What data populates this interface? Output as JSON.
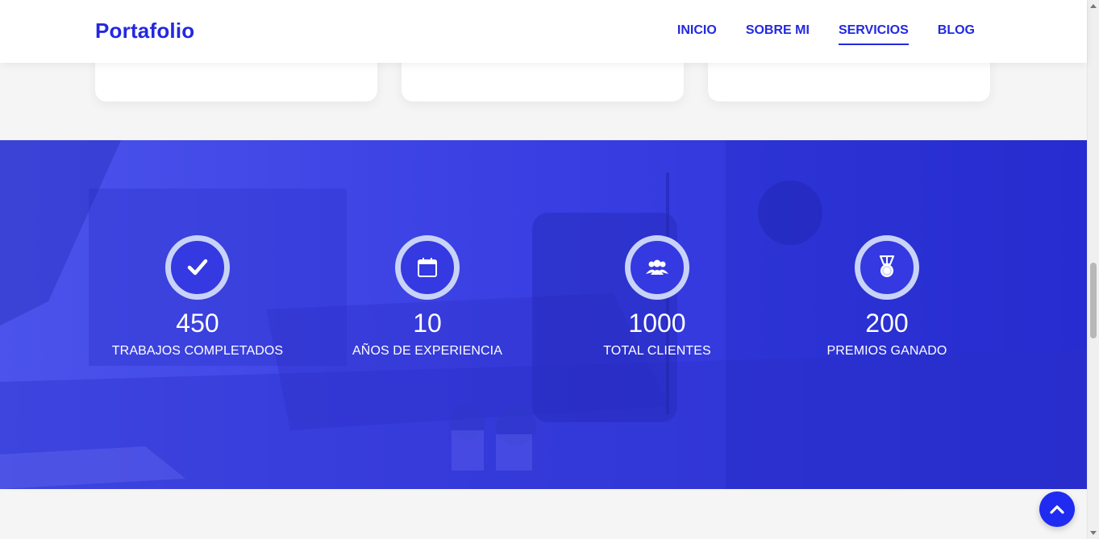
{
  "brand": {
    "name": "Portafolio"
  },
  "nav": {
    "items": [
      {
        "label": "INICIO"
      },
      {
        "label": "SOBRE MI"
      },
      {
        "label": "SERVICIOS",
        "active": true
      },
      {
        "label": "BLOG"
      }
    ]
  },
  "stats": [
    {
      "value": "450",
      "label": "TRABAJOS COMPLETADOS",
      "icon": "check-icon"
    },
    {
      "value": "10",
      "label": "AÑOS DE EXPERIENCIA",
      "icon": "calendar-icon"
    },
    {
      "value": "1000",
      "label": "TOTAL CLIENTES",
      "icon": "users-icon"
    },
    {
      "value": "200",
      "label": "PREMIOS GANADO",
      "icon": "medal-icon"
    }
  ],
  "colors": {
    "accent": "#2328e0",
    "band": "#3a40e2",
    "ring": "#c9d3f7",
    "back_to_top": "#1f2bf0"
  }
}
